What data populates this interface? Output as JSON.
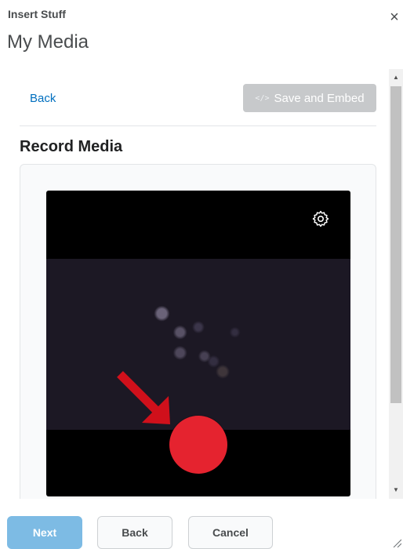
{
  "dialog": {
    "subtitle": "Insert Stuff",
    "title": "My Media",
    "close_glyph": "×"
  },
  "toolbar": {
    "back_label": "Back",
    "save_embed_label": "Save and Embed",
    "save_embed_icon": "</>"
  },
  "recorder": {
    "section_title": "Record Media",
    "settings_icon": "gear-icon",
    "record_button_color": "#e5232f",
    "annotation_arrow_color": "#d0101b"
  },
  "footer": {
    "next_label": "Next",
    "back_label": "Back",
    "cancel_label": "Cancel"
  },
  "colors": {
    "link": "#006fbf",
    "primary_disabled": "#7dbbe4",
    "save_disabled": "#c7c9cb"
  }
}
